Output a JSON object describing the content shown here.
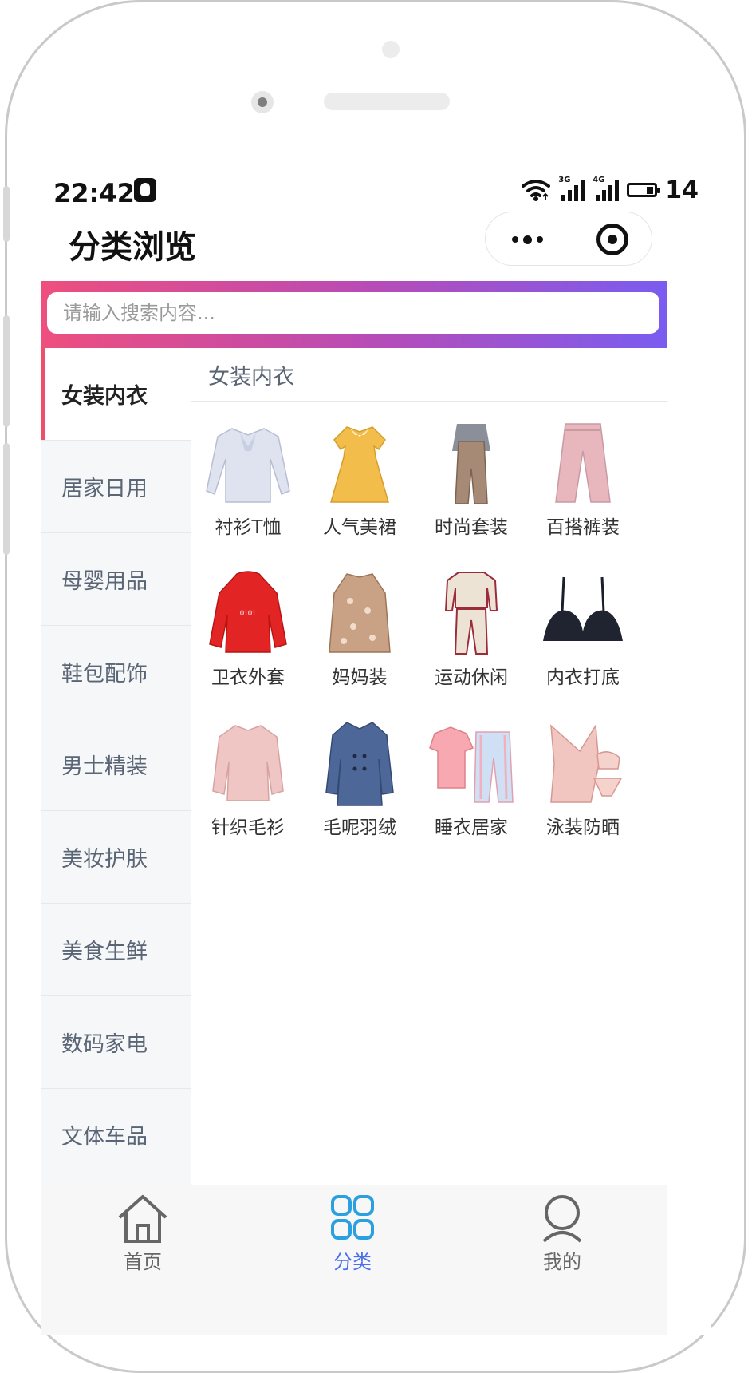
{
  "status": {
    "time": "22:42",
    "net1": "3G",
    "net2": "4G",
    "battery": "14"
  },
  "nav": {
    "title": "分类浏览"
  },
  "search": {
    "placeholder": "请输入搜索内容..."
  },
  "sidebar": {
    "items": [
      {
        "label": "女装内衣"
      },
      {
        "label": "居家日用"
      },
      {
        "label": "母婴用品"
      },
      {
        "label": "鞋包配饰"
      },
      {
        "label": "男士精装"
      },
      {
        "label": "美妆护肤"
      },
      {
        "label": "美食生鲜"
      },
      {
        "label": "数码家电"
      },
      {
        "label": "文体车品"
      }
    ],
    "active": "女装内衣"
  },
  "content": {
    "heading": "女装内衣",
    "products": [
      {
        "label": "衬衫T恤",
        "icon": "blouse-icon"
      },
      {
        "label": "人气美裙",
        "icon": "dress-icon"
      },
      {
        "label": "时尚套装",
        "icon": "overall-set-icon"
      },
      {
        "label": "百搭裤装",
        "icon": "pants-icon"
      },
      {
        "label": "卫衣外套",
        "icon": "hoodie-icon"
      },
      {
        "label": "妈妈装",
        "icon": "floral-dress-icon"
      },
      {
        "label": "运动休闲",
        "icon": "tracksuit-icon"
      },
      {
        "label": "内衣打底",
        "icon": "bra-icon"
      },
      {
        "label": "针织毛衫",
        "icon": "sweater-icon"
      },
      {
        "label": "毛呢羽绒",
        "icon": "coat-icon"
      },
      {
        "label": "睡衣居家",
        "icon": "pajamas-icon"
      },
      {
        "label": "泳装防晒",
        "icon": "swimwear-icon"
      }
    ]
  },
  "tabbar": {
    "items": [
      {
        "label": "首页",
        "icon": "home-icon"
      },
      {
        "label": "分类",
        "icon": "category-grid-icon"
      },
      {
        "label": "我的",
        "icon": "user-icon"
      }
    ],
    "active": "分类"
  },
  "colors": {
    "accent": "#4a6ef0",
    "gradient_start": "#ee4f7e",
    "gradient_end": "#7a5cf0",
    "active_marker": "#ee4f6a"
  }
}
